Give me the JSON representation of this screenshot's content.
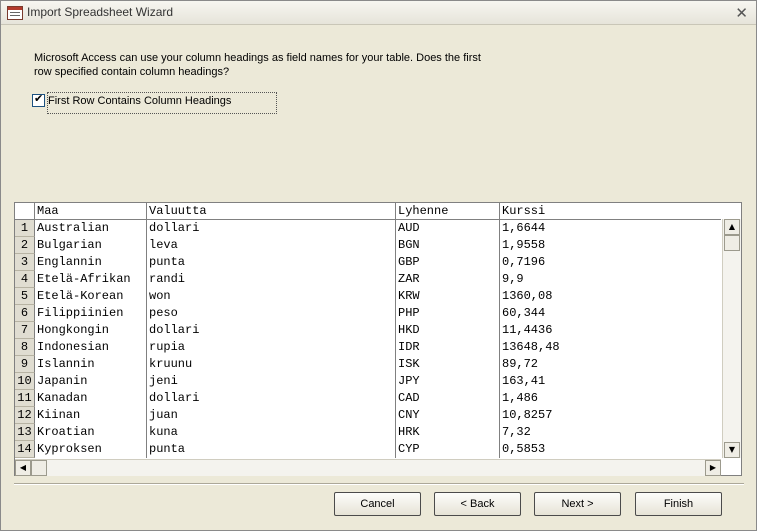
{
  "window": {
    "title": "Import Spreadsheet Wizard"
  },
  "prompt": "Microsoft Access can use your column headings as field names for your table. Does the first row specified contain column headings?",
  "checkbox": {
    "label": "First Row Contains Column Headings",
    "checked": true,
    "mark": "✔"
  },
  "grid": {
    "columns": [
      "Maa",
      "Valuutta",
      "Lyhenne",
      "Kurssi"
    ],
    "rows": [
      {
        "num": "1",
        "cells": [
          "Australian",
          "dollari",
          "AUD",
          "1,6644"
        ]
      },
      {
        "num": "2",
        "cells": [
          "Bulgarian",
          "leva",
          "BGN",
          "1,9558"
        ]
      },
      {
        "num": "3",
        "cells": [
          "Englannin",
          "punta",
          "GBP",
          "0,7196"
        ]
      },
      {
        "num": "4",
        "cells": [
          "Etelä-Afrikan",
          "randi",
          "ZAR",
          "9,9"
        ]
      },
      {
        "num": "5",
        "cells": [
          "Etelä-Korean",
          "won",
          "KRW",
          "1360,08"
        ]
      },
      {
        "num": "6",
        "cells": [
          "Filippiinien",
          "peso",
          "PHP",
          "60,344"
        ]
      },
      {
        "num": "7",
        "cells": [
          "Hongkongin",
          "dollari",
          "HKD",
          "11,4436"
        ]
      },
      {
        "num": "8",
        "cells": [
          "Indonesian",
          "rupia",
          "IDR",
          "13648,48"
        ]
      },
      {
        "num": "9",
        "cells": [
          "Islannin",
          "kruunu",
          "ISK",
          "89,72"
        ]
      },
      {
        "num": "10",
        "cells": [
          "Japanin",
          "jeni",
          "JPY",
          "163,41"
        ]
      },
      {
        "num": "11",
        "cells": [
          "Kanadan",
          "dollari",
          "CAD",
          "1,486"
        ]
      },
      {
        "num": "12",
        "cells": [
          "Kiinan",
          "juan",
          "CNY",
          "10,8257"
        ]
      },
      {
        "num": "13",
        "cells": [
          "Kroatian",
          "kuna",
          "HRK",
          "7,32"
        ]
      },
      {
        "num": "14",
        "cells": [
          "Kyproksen",
          "punta",
          "CYP",
          "0,5853"
        ]
      }
    ]
  },
  "buttons": {
    "cancel": "Cancel",
    "back": "< Back",
    "next": "Next >",
    "finish": "Finish"
  },
  "icons": {
    "close": "close-icon",
    "app": "access-form-icon"
  }
}
